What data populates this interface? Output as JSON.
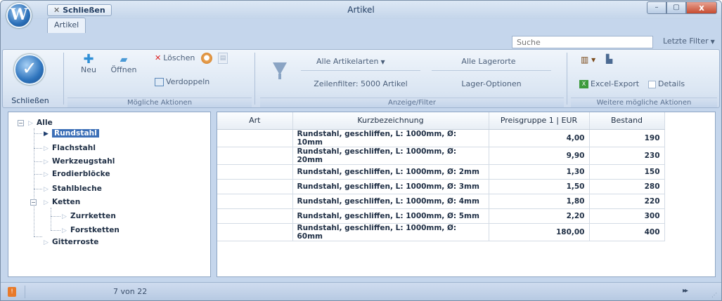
{
  "window": {
    "title": "Artikel",
    "quick_close_label": "Schließen",
    "app_orb": "W",
    "controls": {
      "minimize": "–",
      "maximize": "▢",
      "close": "x"
    }
  },
  "tab": {
    "label": "Artikel"
  },
  "search": {
    "placeholder": "Suche",
    "last_filter_label": "Letzte Filter"
  },
  "ribbon": {
    "close_group": {
      "button_label": "Schließen"
    },
    "actions_group": {
      "label": "Mögliche Aktionen",
      "new_label": "Neu",
      "open_label": "Öffnen",
      "delete_label": "Löschen",
      "duplicate_label": "Verdoppeln"
    },
    "filter_group": {
      "label": "Anzeige/Filter",
      "article_types": "Alle Artikelarten",
      "stores": "Alle Lagerorte",
      "row_filter": "Zeilenfilter: 5000 Artikel",
      "store_options": "Lager-Optionen"
    },
    "more_group": {
      "label": "Weitere mögliche Aktionen",
      "excel_label": "Excel-Export",
      "details_label": "Details"
    }
  },
  "tree": {
    "root": "Alle",
    "nodes": [
      "Rundstahl",
      "Flachstahl",
      "Werkzeugstahl",
      "Erodierblöcke",
      "Stahlbleche",
      "Ketten"
    ],
    "chain_children": [
      "Zurrketten",
      "Forstketten"
    ],
    "last": "Gitterroste",
    "selected": "Rundstahl"
  },
  "grid": {
    "headers": [
      "Art",
      "Kurzbezeichnung",
      "Preisgruppe 1 | EUR",
      "Bestand"
    ],
    "rows": [
      {
        "art": "",
        "name": "Rundstahl, geschliffen, L: 1000mm, Ø: 10mm",
        "price": "4,00",
        "stock": "190"
      },
      {
        "art": "",
        "name": "Rundstahl, geschliffen, L: 1000mm, Ø: 20mm",
        "price": "9,90",
        "stock": "230"
      },
      {
        "art": "",
        "name": "Rundstahl, geschliffen, L: 1000mm, Ø: 2mm",
        "price": "1,30",
        "stock": "150"
      },
      {
        "art": "",
        "name": "Rundstahl, geschliffen, L: 1000mm, Ø: 3mm",
        "price": "1,50",
        "stock": "280"
      },
      {
        "art": "",
        "name": "Rundstahl, geschliffen, L: 1000mm, Ø: 4mm",
        "price": "1,80",
        "stock": "220"
      },
      {
        "art": "",
        "name": "Rundstahl, geschliffen, L: 1000mm, Ø: 5mm",
        "price": "2,20",
        "stock": "300"
      },
      {
        "art": "",
        "name": "Rundstahl, geschliffen, L: 1000mm, Ø: 60mm",
        "price": "180,00",
        "stock": "400"
      }
    ]
  },
  "status": {
    "record_count": "7 von 22"
  },
  "colors": {
    "accent": "#3c6fb7",
    "window_bg": "#c5d6ec",
    "close_button": "#c64b2f"
  }
}
